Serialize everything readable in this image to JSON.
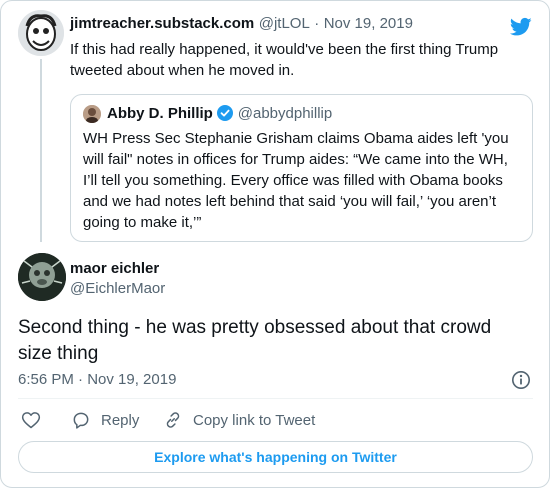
{
  "tweet": {
    "replied_to": {
      "display_name": "jimtreacher.substack.com",
      "handle": "@jtLOL",
      "separator": "·",
      "date": "Nov 19, 2019",
      "text_line1": "If this had really happened, it would've been the first thing Trump",
      "text_line2": "tweeted about when he moved in."
    },
    "quoted": {
      "display_name": "Abby D. Phillip",
      "handle": "@abbydphillip",
      "lines": [
        "WH Press Sec Stephanie Grisham claims Obama aides left 'you",
        "will fail\" notes in offices for Trump aides: “We came into the WH,",
        "I’ll tell you something. Every office was filled with Obama books",
        "and we had notes left behind that said ‘you will fail,’ ‘you aren’t",
        "going to make it,’”"
      ]
    },
    "main": {
      "display_name": "maor eichler",
      "handle": "@EichlerMaor",
      "text_line1": "Second thing - he was pretty obsessed about that crowd",
      "text_line2": "size thing",
      "timestamp": "6:56 PM · Nov 19, 2019"
    },
    "actions": {
      "reply_label": "Reply",
      "copy_link_label": "Copy link to Tweet"
    },
    "explore_label": "Explore what's happening on Twitter"
  },
  "colors": {
    "twitter_blue": "#1d9bf0",
    "text_primary": "#0f1419",
    "text_secondary": "#536471",
    "border": "#cfd9de"
  },
  "icons": [
    "twitter-bird-icon",
    "verified-badge-icon",
    "info-icon",
    "heart-icon",
    "reply-icon",
    "link-icon"
  ]
}
